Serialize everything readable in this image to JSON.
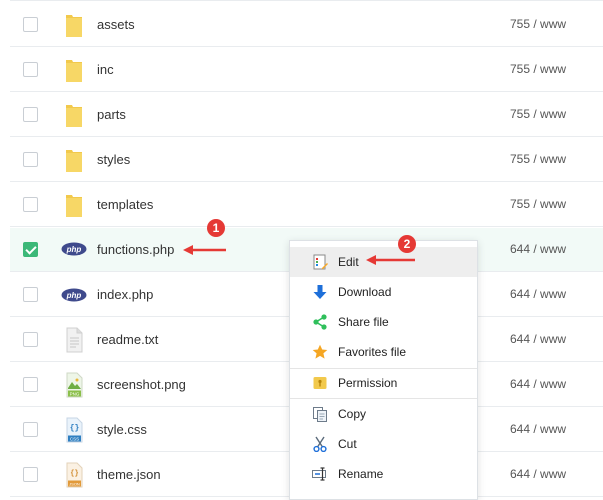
{
  "files": [
    {
      "name": "assets",
      "perm": "755 / www",
      "type": "folder",
      "checked": false
    },
    {
      "name": "inc",
      "perm": "755 / www",
      "type": "folder",
      "checked": false
    },
    {
      "name": "parts",
      "perm": "755 / www",
      "type": "folder",
      "checked": false
    },
    {
      "name": "styles",
      "perm": "755 / www",
      "type": "folder",
      "checked": false
    },
    {
      "name": "templates",
      "perm": "755 / www",
      "type": "folder",
      "checked": false
    },
    {
      "name": "functions.php",
      "perm": "644 / www",
      "type": "php",
      "checked": true
    },
    {
      "name": "index.php",
      "perm": "644 / www",
      "type": "php",
      "checked": false
    },
    {
      "name": "readme.txt",
      "perm": "644 / www",
      "type": "txt",
      "checked": false
    },
    {
      "name": "screenshot.png",
      "perm": "644 / www",
      "type": "png",
      "checked": false
    },
    {
      "name": "style.css",
      "perm": "644 / www",
      "type": "css",
      "checked": false
    },
    {
      "name": "theme.json",
      "perm": "644 / www",
      "type": "json",
      "checked": false
    }
  ],
  "context_menu": {
    "items": [
      {
        "label": "Edit",
        "icon": "edit-icon"
      },
      {
        "label": "Download",
        "icon": "download-icon"
      },
      {
        "label": "Share file",
        "icon": "share-icon"
      },
      {
        "label": "Favorites file",
        "icon": "star-icon"
      },
      {
        "label": "Permission",
        "icon": "permission-icon"
      },
      {
        "label": "Copy",
        "icon": "copy-icon"
      },
      {
        "label": "Cut",
        "icon": "cut-icon"
      },
      {
        "label": "Rename",
        "icon": "rename-icon"
      }
    ]
  },
  "annotations": {
    "step1": "1",
    "step2": "2"
  },
  "file_icon_text": {
    "php": "php",
    "png": "PNG",
    "css": "CSS",
    "json": "JSON"
  }
}
